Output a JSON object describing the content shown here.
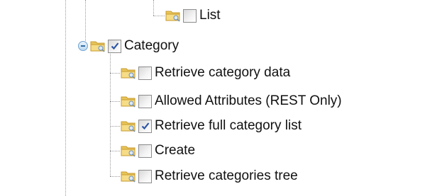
{
  "tree": {
    "list_item": {
      "label": "List",
      "checked": false
    },
    "category": {
      "label": "Category",
      "checked": true,
      "expanded": true,
      "children": [
        {
          "label": "Retrieve category data",
          "checked": false
        },
        {
          "label": "Allowed Attributes (REST Only)",
          "checked": false
        },
        {
          "label": "Retrieve full category list",
          "checked": true
        },
        {
          "label": "Create",
          "checked": false
        },
        {
          "label": "Retrieve categories tree",
          "checked": false
        }
      ]
    }
  },
  "colors": {
    "checkmark": "#2b55a6",
    "folder": "#f2d06a",
    "guide": "#9a9a9a",
    "toggle": "#6fa3cf"
  },
  "icons": {
    "folder": "folder-icon",
    "toggle": "collapse-toggle-icon",
    "checkmark": "checkmark-icon"
  }
}
